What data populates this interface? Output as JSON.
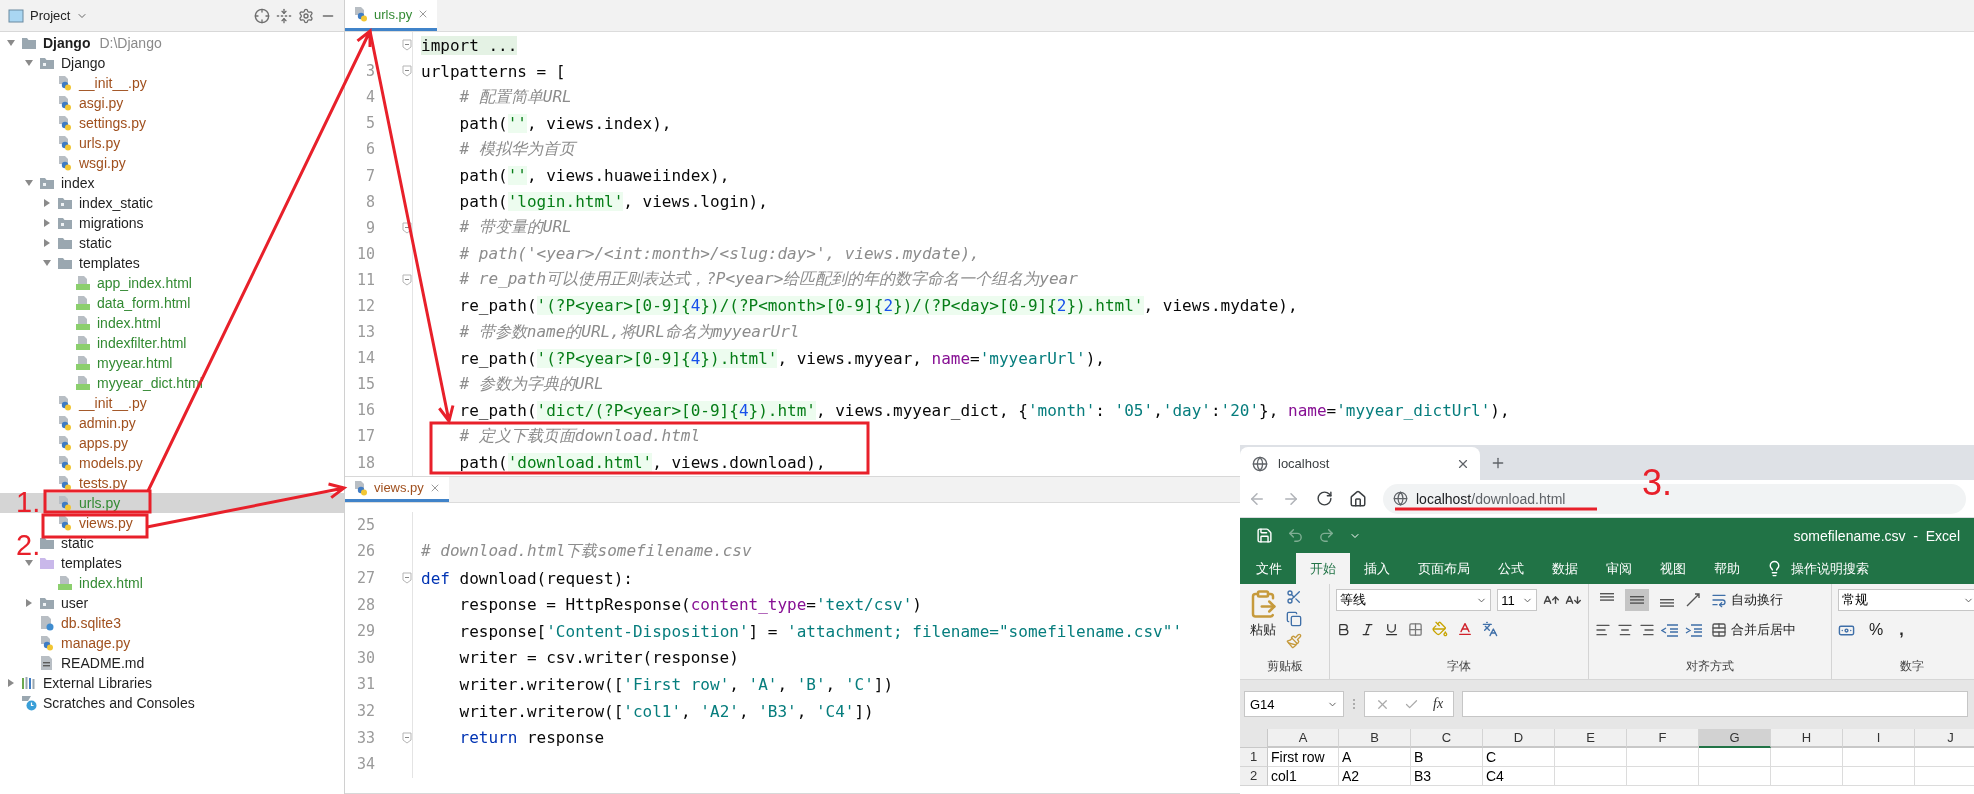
{
  "project_panel": {
    "title": "Project",
    "tree": [
      {
        "label": "Django",
        "path": "D:\\Django",
        "kind": "folder",
        "color": "#1f1f1f",
        "selected": false,
        "expanded": true,
        "children": [
          {
            "label": "Django",
            "kind": "module",
            "color": "#1f1f1f",
            "selected": false,
            "expanded": true,
            "children": [
              {
                "label": "__init__.py",
                "kind": "python",
                "color": "#a0501e",
                "selected": false
              },
              {
                "label": "asgi.py",
                "kind": "python",
                "color": "#a0501e",
                "selected": false
              },
              {
                "label": "settings.py",
                "kind": "python",
                "color": "#a0501e",
                "selected": false
              },
              {
                "label": "urls.py",
                "kind": "python",
                "color": "#a0501e",
                "selected": false
              },
              {
                "label": "wsgi.py",
                "kind": "python",
                "color": "#a0501e",
                "selected": false
              }
            ]
          },
          {
            "label": "index",
            "kind": "module",
            "color": "#1f1f1f",
            "selected": false,
            "expanded": true,
            "children": [
              {
                "label": "index_static",
                "kind": "module",
                "color": "#1f1f1f",
                "selected": false,
                "expanded": false
              },
              {
                "label": "migrations",
                "kind": "module",
                "color": "#1f1f1f",
                "selected": false,
                "expanded": false
              },
              {
                "label": "static",
                "kind": "folder",
                "color": "#1f1f1f",
                "selected": false,
                "expanded": false
              },
              {
                "label": "templates",
                "kind": "folder",
                "color": "#1f1f1f",
                "selected": false,
                "expanded": true,
                "children": [
                  {
                    "label": "app_index.html",
                    "kind": "html",
                    "color": "#338a33",
                    "selected": false
                  },
                  {
                    "label": "data_form.html",
                    "kind": "html",
                    "color": "#338a33",
                    "selected": false
                  },
                  {
                    "label": "index.html",
                    "kind": "html",
                    "color": "#338a33",
                    "selected": false
                  },
                  {
                    "label": "indexfilter.html",
                    "kind": "html",
                    "color": "#338a33",
                    "selected": false
                  },
                  {
                    "label": "myyear.html",
                    "kind": "html",
                    "color": "#338a33",
                    "selected": false
                  },
                  {
                    "label": "myyear_dict.html",
                    "kind": "html",
                    "color": "#338a33",
                    "selected": false
                  }
                ]
              },
              {
                "label": "__init__.py",
                "kind": "python",
                "color": "#a0501e",
                "selected": false
              },
              {
                "label": "admin.py",
                "kind": "python",
                "color": "#a0501e",
                "selected": false
              },
              {
                "label": "apps.py",
                "kind": "python",
                "color": "#a0501e",
                "selected": false
              },
              {
                "label": "models.py",
                "kind": "python",
                "color": "#a0501e",
                "selected": false
              },
              {
                "label": "tests.py",
                "kind": "python",
                "color": "#a0501e",
                "selected": false
              },
              {
                "label": "urls.py",
                "kind": "python",
                "color": "#338a33",
                "selected": true,
                "step": "1."
              },
              {
                "label": "views.py",
                "kind": "python",
                "color": "#a0501e",
                "selected": false
              }
            ]
          },
          {
            "label": "static",
            "kind": "folder",
            "color": "#1f1f1f",
            "selected": false,
            "step": "2."
          },
          {
            "label": "templates",
            "kind": "template-folder",
            "color": "#1f1f1f",
            "selected": false,
            "expanded": true,
            "children": [
              {
                "label": "index.html",
                "kind": "html",
                "color": "#338a33",
                "selected": false
              }
            ]
          },
          {
            "label": "user",
            "kind": "module",
            "color": "#1f1f1f",
            "selected": false,
            "expanded": false
          },
          {
            "label": "db.sqlite3",
            "kind": "sqlite",
            "color": "#a0501e",
            "selected": false
          },
          {
            "label": "manage.py",
            "kind": "python",
            "color": "#a0501e",
            "selected": false
          },
          {
            "label": "README.md",
            "kind": "markdown",
            "color": "#1f1f1f",
            "selected": false
          }
        ]
      },
      {
        "label": "External Libraries",
        "kind": "libraries",
        "color": "#1f1f1f",
        "selected": false,
        "expanded": false
      },
      {
        "label": "Scratches and Consoles",
        "kind": "scratches",
        "color": "#1f1f1f",
        "selected": false
      }
    ]
  },
  "editors": [
    {
      "tab": {
        "label": "urls.py",
        "selected": true,
        "color": "#338a33"
      },
      "lines": [
        {
          "fold": true,
          "tokens": [
            {
              "kind": "folded",
              "text": "import ..."
            }
          ]
        },
        {
          "number": "3",
          "fold": true,
          "tokens": [
            {
              "kind": "plain",
              "text": "urlpatterns = ["
            }
          ]
        },
        {
          "number": "4",
          "tokens": [
            {
              "kind": "comment",
              "text": "    # 配置简单URL"
            }
          ]
        },
        {
          "number": "5",
          "tokens": [
            {
              "kind": "plain",
              "text": "    path("
            },
            {
              "kind": "string",
              "text": "''"
            },
            {
              "kind": "plain",
              "text": ", views.index),"
            }
          ]
        },
        {
          "number": "6",
          "tokens": [
            {
              "kind": "comment",
              "text": "    # 模拟华为首页"
            }
          ]
        },
        {
          "number": "7",
          "tokens": [
            {
              "kind": "plain",
              "text": "    path("
            },
            {
              "kind": "string",
              "text": "''"
            },
            {
              "kind": "plain",
              "text": ", views.huaweiindex),"
            }
          ]
        },
        {
          "number": "8",
          "tokens": [
            {
              "kind": "plain",
              "text": "    path("
            },
            {
              "kind": "string",
              "text": "'login.html'"
            },
            {
              "kind": "plain",
              "text": ", views.login),"
            }
          ]
        },
        {
          "number": "9",
          "fold": true,
          "tokens": [
            {
              "kind": "comment",
              "text": "    # 带变量的URL"
            }
          ]
        },
        {
          "number": "10",
          "tokens": [
            {
              "kind": "comment",
              "text": "    # path('<year>/<int:month>/<slug:day>', views.mydate),"
            }
          ]
        },
        {
          "number": "11",
          "fold": true,
          "tokens": [
            {
              "kind": "comment",
              "text": "    # re_path可以使用正则表达式，?P<year>给匹配到的年的数字命名一个组名为year"
            }
          ]
        },
        {
          "number": "12",
          "tokens": [
            {
              "kind": "plain",
              "text": "    re_path("
            },
            {
              "kind": "string",
              "text": "'(?P<year>[0-9]{"
            },
            {
              "kind": "number",
              "text": "4"
            },
            {
              "kind": "string",
              "text": "})/(?P<month>[0-9]{"
            },
            {
              "kind": "number",
              "text": "2"
            },
            {
              "kind": "string",
              "text": "})/(?P<day>[0-9]{"
            },
            {
              "kind": "number",
              "text": "2"
            },
            {
              "kind": "string",
              "text": "}).html'"
            },
            {
              "kind": "plain",
              "text": ", views.mydate),"
            }
          ]
        },
        {
          "number": "13",
          "tokens": [
            {
              "kind": "comment",
              "text": "    # 带参数name的URL,将URL命名为myyearUrl"
            }
          ]
        },
        {
          "number": "14",
          "tokens": [
            {
              "kind": "plain",
              "text": "    re_path("
            },
            {
              "kind": "string",
              "text": "'(?P<year>[0-9]{"
            },
            {
              "kind": "number",
              "text": "4"
            },
            {
              "kind": "string",
              "text": "}).html'"
            },
            {
              "kind": "plain",
              "text": ", views.myyear, "
            },
            {
              "kind": "param",
              "text": "name"
            },
            {
              "kind": "plain",
              "text": "="
            },
            {
              "kind": "teal",
              "text": "'myyearUrl'"
            },
            {
              "kind": "plain",
              "text": "),"
            }
          ]
        },
        {
          "number": "15",
          "tokens": [
            {
              "kind": "comment",
              "text": "    # 参数为字典的URL"
            }
          ]
        },
        {
          "number": "16",
          "tokens": [
            {
              "kind": "plain",
              "text": "    re_path("
            },
            {
              "kind": "string",
              "text": "'dict/(?P<year>[0-9]{"
            },
            {
              "kind": "number",
              "text": "4"
            },
            {
              "kind": "string",
              "text": "}).htm'"
            },
            {
              "kind": "plain",
              "text": ", views.myyear_dict, {"
            },
            {
              "kind": "teal",
              "text": "'month'"
            },
            {
              "kind": "plain",
              "text": ": "
            },
            {
              "kind": "teal",
              "text": "'05'"
            },
            {
              "kind": "plain",
              "text": ","
            },
            {
              "kind": "teal",
              "text": "'day'"
            },
            {
              "kind": "plain",
              "text": ":"
            },
            {
              "kind": "teal",
              "text": "'20'"
            },
            {
              "kind": "plain",
              "text": "}, "
            },
            {
              "kind": "param",
              "text": "name"
            },
            {
              "kind": "plain",
              "text": "="
            },
            {
              "kind": "teal",
              "text": "'myyear_dictUrl'"
            },
            {
              "kind": "plain",
              "text": "),"
            }
          ]
        },
        {
          "number": "17",
          "tokens": [
            {
              "kind": "comment",
              "text": "    # 定义下载页面download.html"
            }
          ]
        },
        {
          "number": "18",
          "tokens": [
            {
              "kind": "plain",
              "text": "    path("
            },
            {
              "kind": "string",
              "text": "'download.html'"
            },
            {
              "kind": "plain",
              "text": ", views.download),"
            }
          ]
        }
      ]
    },
    {
      "tab": {
        "label": "views.py",
        "selected": true,
        "color": "#a0501e"
      },
      "lines": [
        {
          "number": "25"
        },
        {
          "number": "26",
          "tokens": [
            {
              "kind": "comment",
              "text": "# download.html下载somefilename.csv"
            }
          ]
        },
        {
          "number": "27",
          "fold": true,
          "tokens": [
            {
              "kind": "keyword",
              "text": "def"
            },
            {
              "kind": "plain",
              "text": " download(request):"
            }
          ]
        },
        {
          "number": "28",
          "tokens": [
            {
              "kind": "plain",
              "text": "    response = HttpResponse("
            },
            {
              "kind": "param",
              "text": "content_type"
            },
            {
              "kind": "plain",
              "text": "="
            },
            {
              "kind": "teal",
              "text": "'text/csv'"
            },
            {
              "kind": "plain",
              "text": ")"
            }
          ]
        },
        {
          "number": "29",
          "tokens": [
            {
              "kind": "plain",
              "text": "    response["
            },
            {
              "kind": "teal",
              "text": "'Content-Disposition'"
            },
            {
              "kind": "plain",
              "text": "] = "
            },
            {
              "kind": "teal",
              "text": "'attachment; filename=\"somefilename.csv\"'"
            }
          ]
        },
        {
          "number": "30",
          "tokens": [
            {
              "kind": "plain",
              "text": "    writer = csv.writer(response)"
            }
          ]
        },
        {
          "number": "31",
          "tokens": [
            {
              "kind": "plain",
              "text": "    writer.writerow(["
            },
            {
              "kind": "teal",
              "text": "'First row'"
            },
            {
              "kind": "plain",
              "text": ", "
            },
            {
              "kind": "teal",
              "text": "'A'"
            },
            {
              "kind": "plain",
              "text": ", "
            },
            {
              "kind": "teal",
              "text": "'B'"
            },
            {
              "kind": "plain",
              "text": ", "
            },
            {
              "kind": "teal",
              "text": "'C'"
            },
            {
              "kind": "plain",
              "text": "])"
            }
          ]
        },
        {
          "number": "32",
          "tokens": [
            {
              "kind": "plain",
              "text": "    writer.writerow(["
            },
            {
              "kind": "teal",
              "text": "'col1'"
            },
            {
              "kind": "plain",
              "text": ", "
            },
            {
              "kind": "teal",
              "text": "'A2'"
            },
            {
              "kind": "plain",
              "text": ", "
            },
            {
              "kind": "teal",
              "text": "'B3'"
            },
            {
              "kind": "plain",
              "text": ", "
            },
            {
              "kind": "teal",
              "text": "'C4'"
            },
            {
              "kind": "plain",
              "text": "])"
            }
          ]
        },
        {
          "number": "33",
          "fold": true,
          "tokens": [
            {
              "kind": "keyword",
              "text": "    return"
            },
            {
              "kind": "plain",
              "text": " response"
            }
          ]
        },
        {
          "number": "34"
        }
      ]
    }
  ],
  "browser": {
    "tab_title": "localhost",
    "address_host": "localhost",
    "address_path": "/download.html",
    "step": "3."
  },
  "excel": {
    "title": "somefilename.csv  -  Excel",
    "ribbon_tabs": [
      {
        "label": "文件",
        "selected": false
      },
      {
        "label": "开始",
        "selected": true
      },
      {
        "label": "插入",
        "selected": false
      },
      {
        "label": "页面布局",
        "selected": false
      },
      {
        "label": "公式",
        "selected": false
      },
      {
        "label": "数据",
        "selected": false
      },
      {
        "label": "审阅",
        "selected": false
      },
      {
        "label": "视图",
        "selected": false
      },
      {
        "label": "帮助",
        "selected": false
      }
    ],
    "tell_me": "操作说明搜索",
    "clipboard": {
      "label": "剪贴板",
      "paste": "粘贴"
    },
    "font": {
      "label": "字体",
      "name": "等线",
      "size": "11"
    },
    "alignment": {
      "label": "对齐方式",
      "wrap": "自动换行",
      "merge": "合并后居中",
      "vertical": [
        {
          "selected": false
        },
        {
          "selected": true
        },
        {
          "selected": false
        }
      ]
    },
    "number": {
      "label": "数字",
      "format": "常规",
      "percent": "%",
      "comma": ","
    },
    "name_box": "G14",
    "function_symbol": "fx",
    "columns": [
      {
        "label": "A",
        "selected": false
      },
      {
        "label": "B",
        "selected": false
      },
      {
        "label": "C",
        "selected": false
      },
      {
        "label": "D",
        "selected": false
      },
      {
        "label": "E",
        "selected": false
      },
      {
        "label": "F",
        "selected": false
      },
      {
        "label": "G",
        "selected": true
      },
      {
        "label": "H",
        "selected": false
      },
      {
        "label": "I",
        "selected": false
      },
      {
        "label": "J",
        "selected": false
      }
    ],
    "rows": [
      {
        "number": "1",
        "cells": [
          "First row",
          "A",
          "B",
          "C"
        ]
      },
      {
        "number": "2",
        "cells": [
          "col1",
          "A2",
          "B3",
          "C4"
        ]
      }
    ]
  }
}
